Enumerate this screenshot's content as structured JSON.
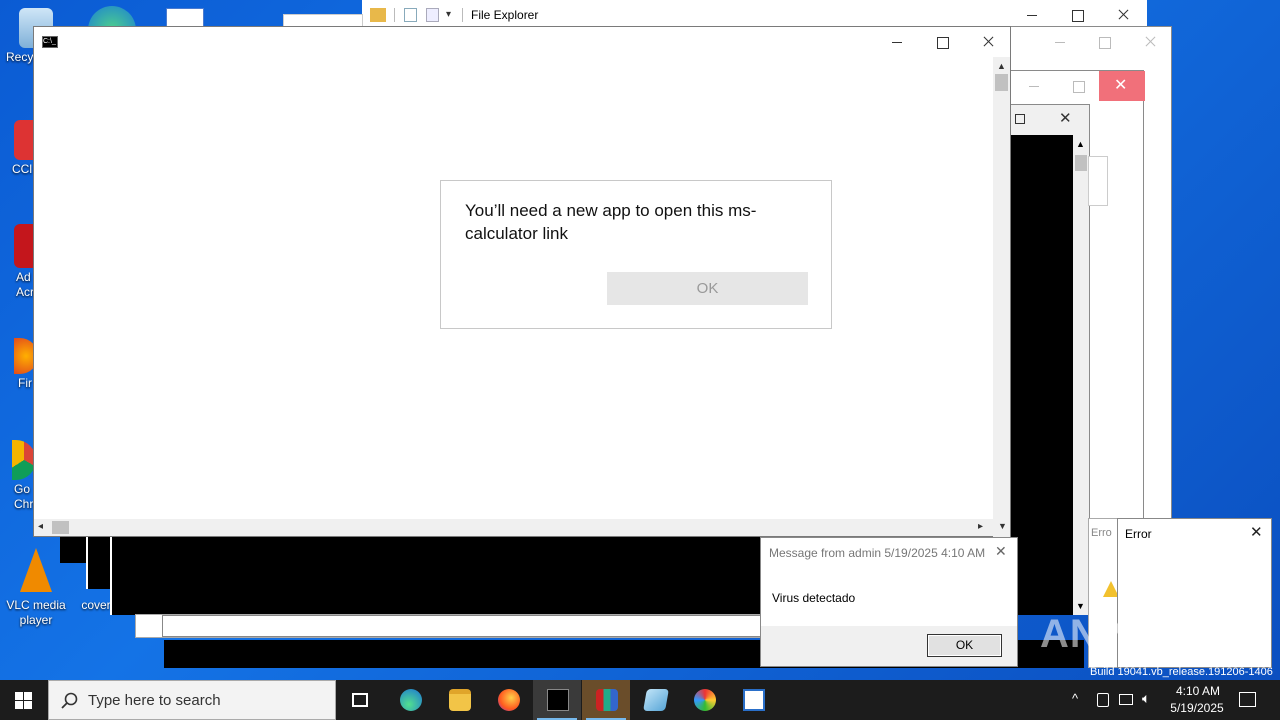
{
  "desktop": {
    "icons": [
      {
        "label": "Recy",
        "icon": "recycle-bin-icon"
      },
      {
        "label": "CCl",
        "icon": "ccleaner-icon"
      },
      {
        "label": "Ad Acr",
        "icon": "acrobat-icon"
      },
      {
        "label": "Fir",
        "icon": "firefox-icon"
      },
      {
        "label": "Go Chr",
        "icon": "chrome-icon"
      },
      {
        "label": "VLC media player",
        "icon": "vlc-icon"
      },
      {
        "label": "cover",
        "icon": "file-icon"
      }
    ],
    "watermark": "ANY RUN",
    "build_text": "Build 19041.vb_release.191206-1406"
  },
  "file_explorer": {
    "title": "File Explorer"
  },
  "dialog": {
    "message": "You’ll need a new app to open this ms-calculator link",
    "ok_label": "OK"
  },
  "message_box": {
    "title": "Message from admin 5/19/2025 4:10 AM",
    "body": "Virus detectado",
    "ok_label": "OK"
  },
  "error_window": {
    "title": "Error",
    "title_partial": "Erro"
  },
  "taskbar": {
    "search_placeholder": "Type here to search",
    "time": "4:10 AM",
    "date": "5/19/2025",
    "apps": [
      "task-view-icon",
      "edge-icon",
      "file-explorer-icon",
      "firefox-icon",
      "cmd-icon",
      "winrar-icon",
      "notepad-icon",
      "paint-icon",
      "wordpad-icon"
    ]
  },
  "colors": {
    "desktop": "#0a64d2",
    "taskbar": "#1c1c1c",
    "console_black": "#000000",
    "close_hover": "#f1707a",
    "accent": "#76b9ed"
  }
}
